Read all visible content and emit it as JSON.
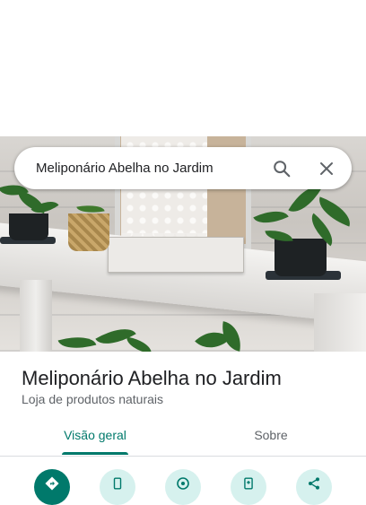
{
  "search": {
    "query": "Meliponário Abelha no Jardim",
    "search_icon": "search-icon",
    "close_icon": "close-icon"
  },
  "place": {
    "name": "Meliponário Abelha no Jardim",
    "category": "Loja de produtos naturais"
  },
  "tabs": [
    {
      "label": "Visão geral",
      "active": true
    },
    {
      "label": "Sobre",
      "active": false
    }
  ],
  "actions": [
    {
      "icon": "directions-icon",
      "style": "primary"
    },
    {
      "icon": "phone-icon",
      "style": "secondary"
    },
    {
      "icon": "website-icon",
      "style": "secondary"
    },
    {
      "icon": "save-icon",
      "style": "secondary"
    },
    {
      "icon": "share-icon",
      "style": "secondary"
    }
  ],
  "colors": {
    "accent": "#00796b",
    "accent_light": "#d6f1ee",
    "text_primary": "#202124",
    "text_secondary": "#5f6368"
  }
}
